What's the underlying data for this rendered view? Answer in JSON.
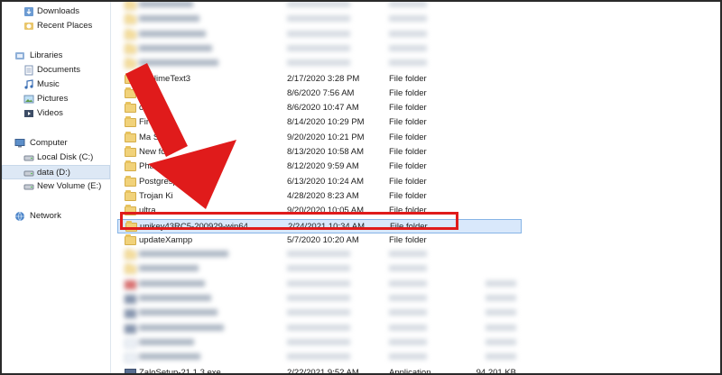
{
  "nav": {
    "favorites": [
      {
        "label": "Downloads",
        "icon": "downloads-icon"
      },
      {
        "label": "Recent Places",
        "icon": "recent-places-icon"
      }
    ],
    "libraries_label": "Libraries",
    "libraries": [
      {
        "label": "Documents",
        "icon": "documents-icon"
      },
      {
        "label": "Music",
        "icon": "music-icon"
      },
      {
        "label": "Pictures",
        "icon": "pictures-icon"
      },
      {
        "label": "Videos",
        "icon": "videos-icon"
      }
    ],
    "computer_label": "Computer",
    "drives": [
      {
        "label": "Local Disk (C:)",
        "icon": "drive-icon",
        "selected": false
      },
      {
        "label": "data (D:)",
        "icon": "drive-icon",
        "selected": true
      },
      {
        "label": "New Volume (E:)",
        "icon": "drive-icon",
        "selected": false
      }
    ],
    "network_label": "Network"
  },
  "files": [
    {
      "name": "",
      "date": "",
      "type": "",
      "size": "",
      "kind": "folder",
      "blur": true
    },
    {
      "name": "",
      "date": "",
      "type": "",
      "size": "",
      "kind": "folder",
      "blur": true
    },
    {
      "name": "",
      "date": "",
      "type": "",
      "size": "",
      "kind": "folder",
      "blur": true
    },
    {
      "name": "",
      "date": "",
      "type": "",
      "size": "",
      "kind": "folder",
      "blur": true
    },
    {
      "name": "",
      "date": "",
      "type": "",
      "size": "",
      "kind": "folder",
      "blur": true
    },
    {
      "name": "SublimeText3",
      "date": "2/17/2020 3:28 PM",
      "type": "File folder",
      "size": "",
      "kind": "folder",
      "blur": false
    },
    {
      "name": "om",
      "date": "8/6/2020 7:56 AM",
      "type": "File folder",
      "size": "",
      "kind": "folder",
      "blur": false
    },
    {
      "name": "cr    ffice",
      "date": "8/6/2020 10:47 AM",
      "type": "File folder",
      "size": "",
      "kind": "folder",
      "blur": false
    },
    {
      "name": "Fire",
      "date": "8/14/2020 10:29 PM",
      "type": "File folder",
      "size": "",
      "kind": "folder",
      "blur": false
    },
    {
      "name": "Ma Sc",
      "date": "9/20/2020 10:21 PM",
      "type": "File folder",
      "size": "",
      "kind": "folder",
      "blur": false
    },
    {
      "name": "New fold",
      "date": "8/13/2020 10:58 AM",
      "type": "File folder",
      "size": "",
      "kind": "folder",
      "blur": false
    },
    {
      "name": "PhamMem",
      "date": "8/12/2020 9:59 AM",
      "type": "File folder",
      "size": "",
      "kind": "folder",
      "blur": false
    },
    {
      "name": "Postgresp",
      "date": "6/13/2020 10:24 AM",
      "type": "File folder",
      "size": "",
      "kind": "folder",
      "blur": false
    },
    {
      "name": "Trojan Ki",
      "date": "4/28/2020 8:23 AM",
      "type": "File folder",
      "size": "",
      "kind": "folder",
      "blur": false
    },
    {
      "name": "ultra",
      "date": "9/20/2020 10:05 AM",
      "type": "File folder",
      "size": "",
      "kind": "folder",
      "blur": false
    },
    {
      "name": "unikey43RC5-200929-win64",
      "date": "2/24/2021 10:34 AM",
      "type": "File folder",
      "size": "",
      "kind": "folder",
      "blur": false,
      "selected": true
    },
    {
      "name": "updateXampp",
      "date": "5/7/2020 10:20 AM",
      "type": "File folder",
      "size": "",
      "kind": "folder",
      "blur": false
    },
    {
      "name": "",
      "date": "",
      "type": "",
      "size": "",
      "kind": "folder",
      "blur": true
    },
    {
      "name": "",
      "date": "",
      "type": "",
      "size": "",
      "kind": "folder",
      "blur": true
    },
    {
      "name": "",
      "date": "",
      "type": "",
      "size": "",
      "kind": "app",
      "blur": true
    },
    {
      "name": "",
      "date": "",
      "type": "",
      "size": "",
      "kind": "install",
      "blur": true
    },
    {
      "name": "",
      "date": "",
      "type": "",
      "size": "",
      "kind": "install",
      "blur": true
    },
    {
      "name": "",
      "date": "",
      "type": "",
      "size": "",
      "kind": "install",
      "blur": true
    },
    {
      "name": "",
      "date": "",
      "type": "",
      "size": "",
      "kind": "file",
      "blur": true
    },
    {
      "name": "",
      "date": "",
      "type": "",
      "size": "",
      "kind": "file",
      "blur": true
    },
    {
      "name": "ZaloSetup-21.1.3.exe",
      "date": "2/22/2021 9:52 AM",
      "type": "Application",
      "size": "94,201 KB",
      "kind": "install",
      "blur": false
    }
  ],
  "overlay": {
    "arrow_color": "#e01b1b",
    "highlight_color": "#e01b1b"
  }
}
